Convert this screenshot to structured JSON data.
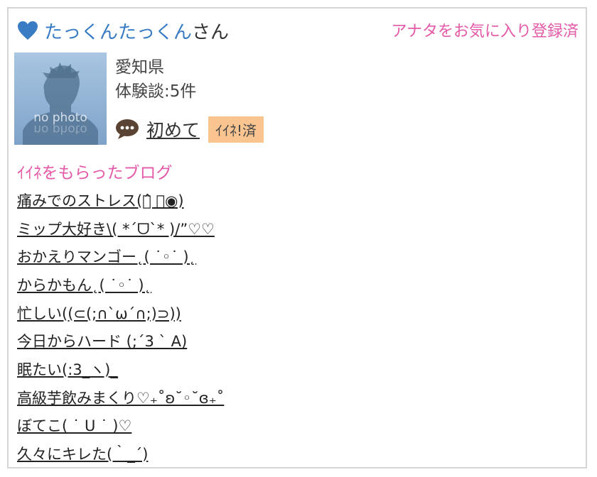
{
  "header": {
    "username": "たっくんたっくん",
    "suffix": "さん",
    "favorite_status": "アナタをお気に入り登録済"
  },
  "profile": {
    "avatar_text": "no photo",
    "prefecture": "愛知県",
    "experience_count": "体験談:5件",
    "status_link": "初めて",
    "iine_badge": "ｲｲﾈ!済"
  },
  "blog": {
    "heading": "ｲｲﾈをもらったブログ",
    "posts": [
      "痛みでのストレス(ฅ̂ ︿◉)",
      "ミップ大好き\\( *´ᗜ`* )/”♡♡",
      "おかえりマンゴー˛( ˙◦˙ )˛",
      "からかもん˛( ˙◦˙ )˛",
      "忙しい((⊂(;∩`ω´∩;)⊃))",
      "今日からハード (;´3 ` A)",
      "眠たい(:3_ヽ)_",
      "高級芋飲みまくり♡₊˚ʚ˘◦˘ɞ₊˚",
      "ぼてこ( ˙ ᑌ ˙ )♡",
      "久々にキレた(｀_´)"
    ]
  },
  "colors": {
    "username": "#3a7cc4",
    "pink": "#e45aa8",
    "badge": "#f9c490",
    "heart": "#3a7cc4"
  }
}
